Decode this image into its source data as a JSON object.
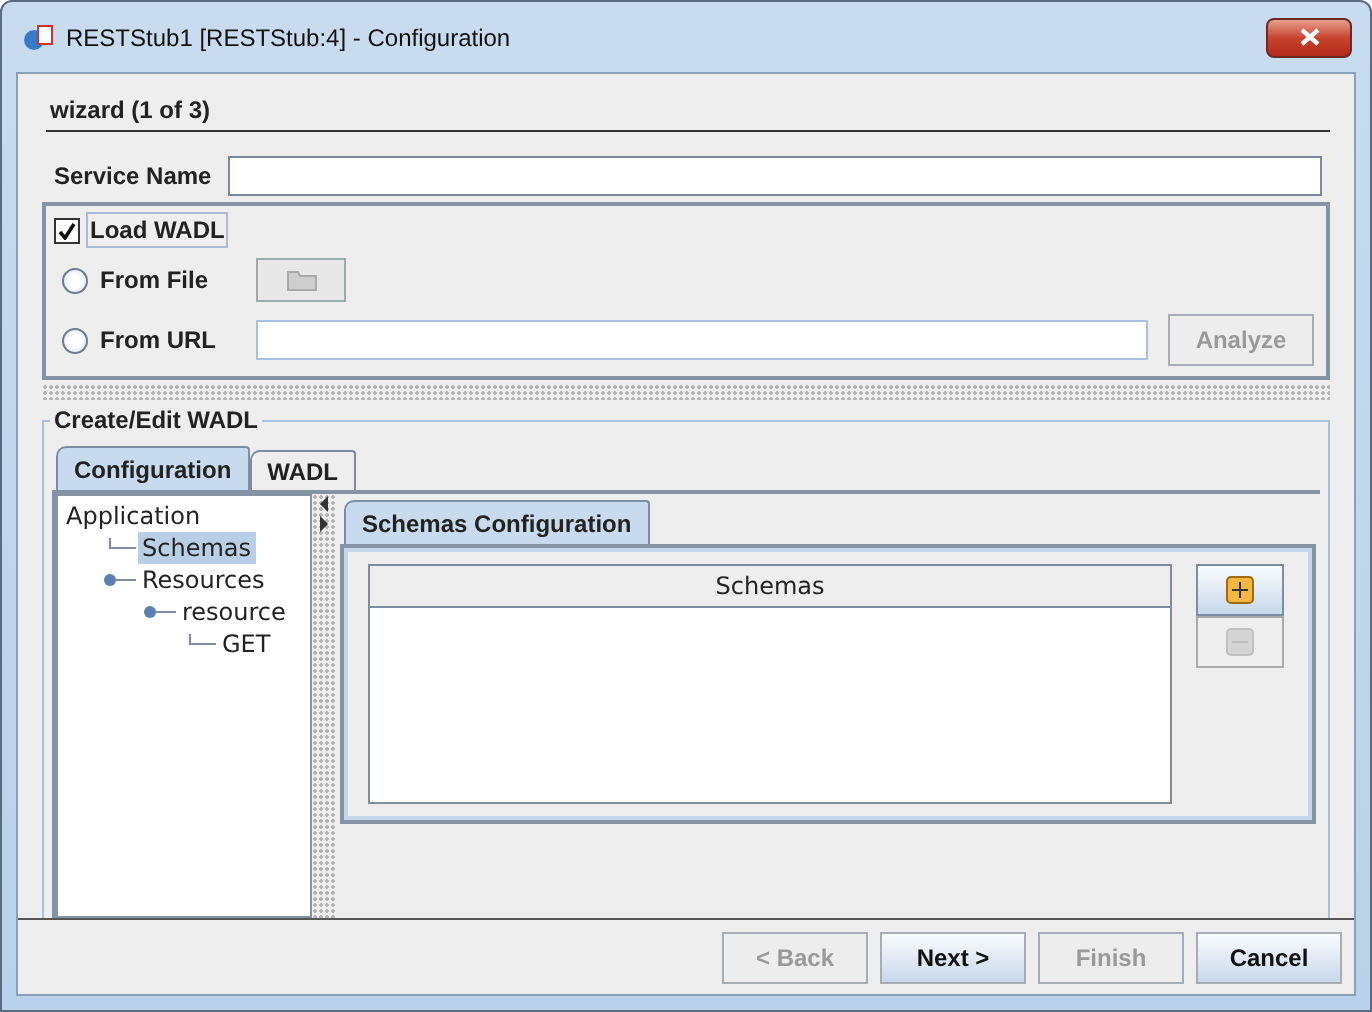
{
  "window": {
    "title": "RESTStub1 [RESTStub:4] - Configuration"
  },
  "wizard": {
    "step": "wizard (1 of 3)"
  },
  "service_name": {
    "label": "Service Name"
  },
  "load_wadl": {
    "label": "Load WADL",
    "checked": true,
    "sources": [
      {
        "kind": "file",
        "label": "From File",
        "selected": false
      },
      {
        "kind": "url",
        "label": "From URL",
        "selected": false
      }
    ],
    "analyze_button": {
      "label": "Analyze",
      "disabled": true
    }
  },
  "create_edit": {
    "title": "Create/Edit WADL",
    "tabs": [
      {
        "label": "Configuration",
        "selected": true
      },
      {
        "label": "WADL",
        "selected": false
      }
    ],
    "tree": [
      {
        "label": "Application",
        "selected": false,
        "children": [
          {
            "label": "Schemas",
            "selected": true
          },
          {
            "label": "Resources",
            "selected": false,
            "children": [
              {
                "label": "resource",
                "selected": false,
                "children": [
                  {
                    "label": "GET",
                    "selected": false
                  }
                ]
              }
            ]
          }
        ]
      }
    ],
    "sub_tabs": [
      {
        "label": "Schemas Configuration",
        "selected": true
      }
    ],
    "table": {
      "columns": [
        "Schemas"
      ]
    },
    "side_buttons": [
      {
        "kind": "add",
        "disabled": false
      },
      {
        "kind": "remove",
        "disabled": true
      }
    ]
  },
  "buttons": [
    {
      "label": "< Back",
      "disabled": true
    },
    {
      "label": "Next >",
      "disabled": false
    },
    {
      "label": "Finish",
      "disabled": true
    },
    {
      "label": "Cancel",
      "disabled": false
    }
  ]
}
